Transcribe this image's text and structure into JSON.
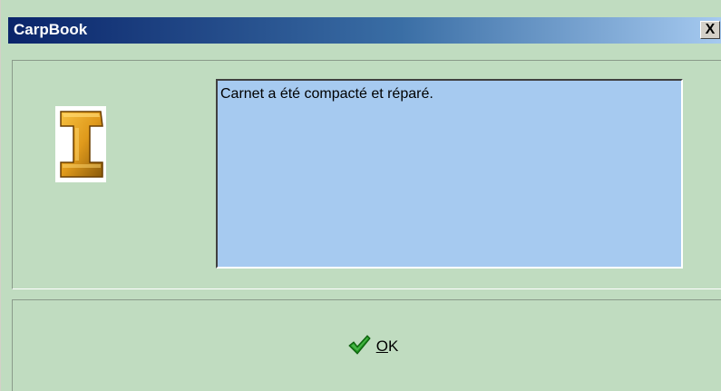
{
  "dialog": {
    "title": "CarpBook",
    "close_label": "X",
    "message": "Carnet a été compacté et réparé.",
    "ok_button": {
      "mnemonic": "O",
      "rest": "K"
    },
    "icons": {
      "info": "info-i-icon",
      "ok": "checkmark-icon",
      "close": "close-icon"
    },
    "colors": {
      "background": "#c0dcc0",
      "message_background": "#a6caf0",
      "title_start": "#0a246a",
      "title_end": "#a6caf0",
      "icon_gold": "#e09a1c",
      "check_green": "#1a8a1a"
    }
  }
}
